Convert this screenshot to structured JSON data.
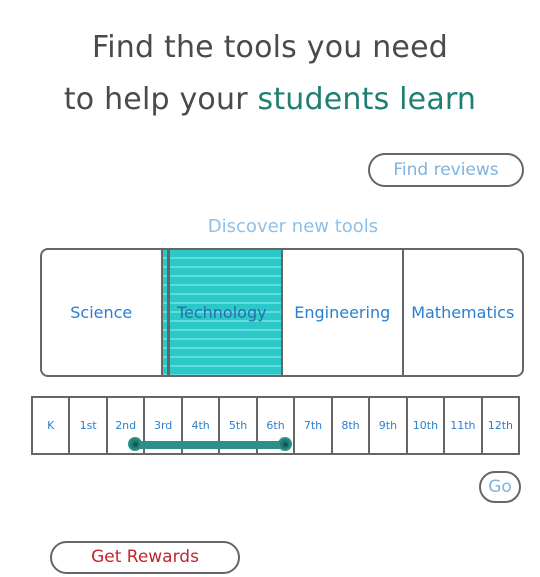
{
  "headline": {
    "line1": "Find the tools you need",
    "line2_prefix": "to help your ",
    "line2_accent": "students learn"
  },
  "find_reviews_label": "Find reviews",
  "discover_label": "Discover new tools",
  "subjects": [
    {
      "label": "Science",
      "selected": false
    },
    {
      "label": "Technology",
      "selected": true
    },
    {
      "label": "Engineering",
      "selected": false
    },
    {
      "label": "Mathematics",
      "selected": false
    }
  ],
  "grades": [
    "K",
    "1st",
    "2nd",
    "3rd",
    "4th",
    "5th",
    "6th",
    "7th",
    "8th",
    "9th",
    "10th",
    "11th",
    "12th"
  ],
  "grade_range": {
    "min": "2nd",
    "max": "6th"
  },
  "go_label": "Go",
  "rewards_label": "Get Rewards",
  "colors": {
    "accent": "#1e7f72",
    "link": "#2a7fd0",
    "selected_fill": "#2cc8c8",
    "rewards": "#c0262d"
  }
}
